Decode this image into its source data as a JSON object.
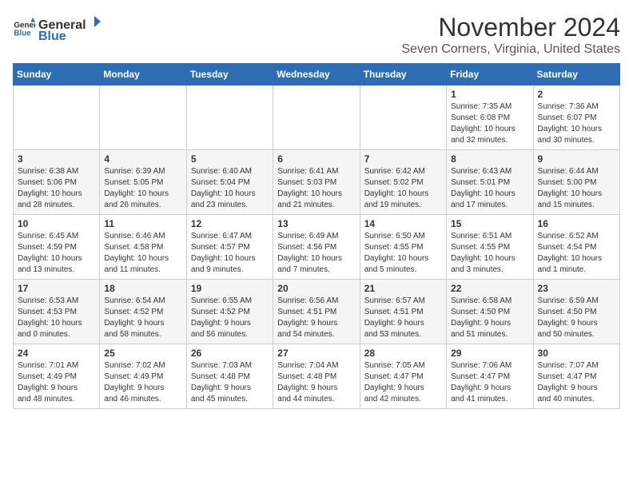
{
  "logo": {
    "general": "General",
    "blue": "Blue"
  },
  "title": "November 2024",
  "location": "Seven Corners, Virginia, United States",
  "days_of_week": [
    "Sunday",
    "Monday",
    "Tuesday",
    "Wednesday",
    "Thursday",
    "Friday",
    "Saturday"
  ],
  "weeks": [
    [
      {
        "day": "",
        "info": ""
      },
      {
        "day": "",
        "info": ""
      },
      {
        "day": "",
        "info": ""
      },
      {
        "day": "",
        "info": ""
      },
      {
        "day": "",
        "info": ""
      },
      {
        "day": "1",
        "info": "Sunrise: 7:35 AM\nSunset: 6:08 PM\nDaylight: 10 hours\nand 32 minutes."
      },
      {
        "day": "2",
        "info": "Sunrise: 7:36 AM\nSunset: 6:07 PM\nDaylight: 10 hours\nand 30 minutes."
      }
    ],
    [
      {
        "day": "3",
        "info": "Sunrise: 6:38 AM\nSunset: 5:06 PM\nDaylight: 10 hours\nand 28 minutes."
      },
      {
        "day": "4",
        "info": "Sunrise: 6:39 AM\nSunset: 5:05 PM\nDaylight: 10 hours\nand 26 minutes."
      },
      {
        "day": "5",
        "info": "Sunrise: 6:40 AM\nSunset: 5:04 PM\nDaylight: 10 hours\nand 23 minutes."
      },
      {
        "day": "6",
        "info": "Sunrise: 6:41 AM\nSunset: 5:03 PM\nDaylight: 10 hours\nand 21 minutes."
      },
      {
        "day": "7",
        "info": "Sunrise: 6:42 AM\nSunset: 5:02 PM\nDaylight: 10 hours\nand 19 minutes."
      },
      {
        "day": "8",
        "info": "Sunrise: 6:43 AM\nSunset: 5:01 PM\nDaylight: 10 hours\nand 17 minutes."
      },
      {
        "day": "9",
        "info": "Sunrise: 6:44 AM\nSunset: 5:00 PM\nDaylight: 10 hours\nand 15 minutes."
      }
    ],
    [
      {
        "day": "10",
        "info": "Sunrise: 6:45 AM\nSunset: 4:59 PM\nDaylight: 10 hours\nand 13 minutes."
      },
      {
        "day": "11",
        "info": "Sunrise: 6:46 AM\nSunset: 4:58 PM\nDaylight: 10 hours\nand 11 minutes."
      },
      {
        "day": "12",
        "info": "Sunrise: 6:47 AM\nSunset: 4:57 PM\nDaylight: 10 hours\nand 9 minutes."
      },
      {
        "day": "13",
        "info": "Sunrise: 6:49 AM\nSunset: 4:56 PM\nDaylight: 10 hours\nand 7 minutes."
      },
      {
        "day": "14",
        "info": "Sunrise: 6:50 AM\nSunset: 4:55 PM\nDaylight: 10 hours\nand 5 minutes."
      },
      {
        "day": "15",
        "info": "Sunrise: 6:51 AM\nSunset: 4:55 PM\nDaylight: 10 hours\nand 3 minutes."
      },
      {
        "day": "16",
        "info": "Sunrise: 6:52 AM\nSunset: 4:54 PM\nDaylight: 10 hours\nand 1 minute."
      }
    ],
    [
      {
        "day": "17",
        "info": "Sunrise: 6:53 AM\nSunset: 4:53 PM\nDaylight: 10 hours\nand 0 minutes."
      },
      {
        "day": "18",
        "info": "Sunrise: 6:54 AM\nSunset: 4:52 PM\nDaylight: 9 hours\nand 58 minutes."
      },
      {
        "day": "19",
        "info": "Sunrise: 6:55 AM\nSunset: 4:52 PM\nDaylight: 9 hours\nand 56 minutes."
      },
      {
        "day": "20",
        "info": "Sunrise: 6:56 AM\nSunset: 4:51 PM\nDaylight: 9 hours\nand 54 minutes."
      },
      {
        "day": "21",
        "info": "Sunrise: 6:57 AM\nSunset: 4:51 PM\nDaylight: 9 hours\nand 53 minutes."
      },
      {
        "day": "22",
        "info": "Sunrise: 6:58 AM\nSunset: 4:50 PM\nDaylight: 9 hours\nand 51 minutes."
      },
      {
        "day": "23",
        "info": "Sunrise: 6:59 AM\nSunset: 4:50 PM\nDaylight: 9 hours\nand 50 minutes."
      }
    ],
    [
      {
        "day": "24",
        "info": "Sunrise: 7:01 AM\nSunset: 4:49 PM\nDaylight: 9 hours\nand 48 minutes."
      },
      {
        "day": "25",
        "info": "Sunrise: 7:02 AM\nSunset: 4:49 PM\nDaylight: 9 hours\nand 46 minutes."
      },
      {
        "day": "26",
        "info": "Sunrise: 7:03 AM\nSunset: 4:48 PM\nDaylight: 9 hours\nand 45 minutes."
      },
      {
        "day": "27",
        "info": "Sunrise: 7:04 AM\nSunset: 4:48 PM\nDaylight: 9 hours\nand 44 minutes."
      },
      {
        "day": "28",
        "info": "Sunrise: 7:05 AM\nSunset: 4:47 PM\nDaylight: 9 hours\nand 42 minutes."
      },
      {
        "day": "29",
        "info": "Sunrise: 7:06 AM\nSunset: 4:47 PM\nDaylight: 9 hours\nand 41 minutes."
      },
      {
        "day": "30",
        "info": "Sunrise: 7:07 AM\nSunset: 4:47 PM\nDaylight: 9 hours\nand 40 minutes."
      }
    ]
  ]
}
